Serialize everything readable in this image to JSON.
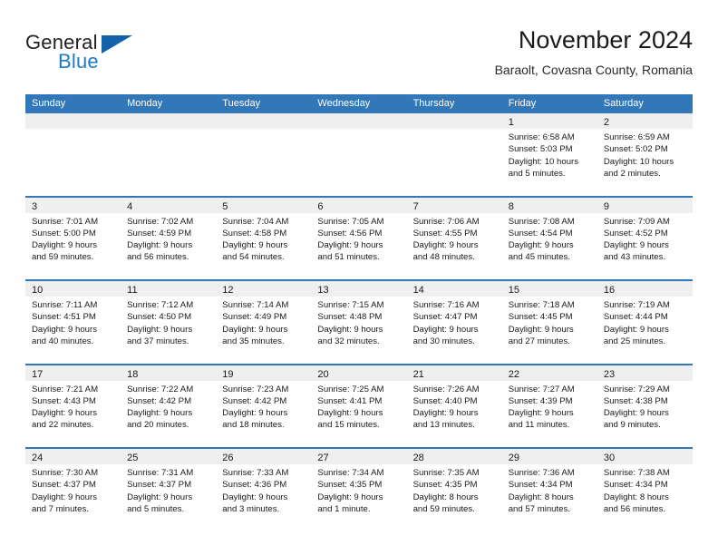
{
  "logo": {
    "word_top": "General",
    "word_bottom": "Blue",
    "triangle_color": "#1361a8",
    "blue_color": "#1b7ac9"
  },
  "header": {
    "title": "November 2024",
    "subtitle": "Baraolt, Covasna County, Romania"
  },
  "theme": {
    "header_blue": "#3277b8",
    "day_band_gray": "#efefef"
  },
  "weekday_headers": [
    "Sunday",
    "Monday",
    "Tuesday",
    "Wednesday",
    "Thursday",
    "Friday",
    "Saturday"
  ],
  "weeks": [
    [
      {
        "day": "",
        "lines": []
      },
      {
        "day": "",
        "lines": []
      },
      {
        "day": "",
        "lines": []
      },
      {
        "day": "",
        "lines": []
      },
      {
        "day": "",
        "lines": []
      },
      {
        "day": "1",
        "lines": [
          "Sunrise: 6:58 AM",
          "Sunset: 5:03 PM",
          "Daylight: 10 hours",
          "and 5 minutes."
        ]
      },
      {
        "day": "2",
        "lines": [
          "Sunrise: 6:59 AM",
          "Sunset: 5:02 PM",
          "Daylight: 10 hours",
          "and 2 minutes."
        ]
      }
    ],
    [
      {
        "day": "3",
        "lines": [
          "Sunrise: 7:01 AM",
          "Sunset: 5:00 PM",
          "Daylight: 9 hours",
          "and 59 minutes."
        ]
      },
      {
        "day": "4",
        "lines": [
          "Sunrise: 7:02 AM",
          "Sunset: 4:59 PM",
          "Daylight: 9 hours",
          "and 56 minutes."
        ]
      },
      {
        "day": "5",
        "lines": [
          "Sunrise: 7:04 AM",
          "Sunset: 4:58 PM",
          "Daylight: 9 hours",
          "and 54 minutes."
        ]
      },
      {
        "day": "6",
        "lines": [
          "Sunrise: 7:05 AM",
          "Sunset: 4:56 PM",
          "Daylight: 9 hours",
          "and 51 minutes."
        ]
      },
      {
        "day": "7",
        "lines": [
          "Sunrise: 7:06 AM",
          "Sunset: 4:55 PM",
          "Daylight: 9 hours",
          "and 48 minutes."
        ]
      },
      {
        "day": "8",
        "lines": [
          "Sunrise: 7:08 AM",
          "Sunset: 4:54 PM",
          "Daylight: 9 hours",
          "and 45 minutes."
        ]
      },
      {
        "day": "9",
        "lines": [
          "Sunrise: 7:09 AM",
          "Sunset: 4:52 PM",
          "Daylight: 9 hours",
          "and 43 minutes."
        ]
      }
    ],
    [
      {
        "day": "10",
        "lines": [
          "Sunrise: 7:11 AM",
          "Sunset: 4:51 PM",
          "Daylight: 9 hours",
          "and 40 minutes."
        ]
      },
      {
        "day": "11",
        "lines": [
          "Sunrise: 7:12 AM",
          "Sunset: 4:50 PM",
          "Daylight: 9 hours",
          "and 37 minutes."
        ]
      },
      {
        "day": "12",
        "lines": [
          "Sunrise: 7:14 AM",
          "Sunset: 4:49 PM",
          "Daylight: 9 hours",
          "and 35 minutes."
        ]
      },
      {
        "day": "13",
        "lines": [
          "Sunrise: 7:15 AM",
          "Sunset: 4:48 PM",
          "Daylight: 9 hours",
          "and 32 minutes."
        ]
      },
      {
        "day": "14",
        "lines": [
          "Sunrise: 7:16 AM",
          "Sunset: 4:47 PM",
          "Daylight: 9 hours",
          "and 30 minutes."
        ]
      },
      {
        "day": "15",
        "lines": [
          "Sunrise: 7:18 AM",
          "Sunset: 4:45 PM",
          "Daylight: 9 hours",
          "and 27 minutes."
        ]
      },
      {
        "day": "16",
        "lines": [
          "Sunrise: 7:19 AM",
          "Sunset: 4:44 PM",
          "Daylight: 9 hours",
          "and 25 minutes."
        ]
      }
    ],
    [
      {
        "day": "17",
        "lines": [
          "Sunrise: 7:21 AM",
          "Sunset: 4:43 PM",
          "Daylight: 9 hours",
          "and 22 minutes."
        ]
      },
      {
        "day": "18",
        "lines": [
          "Sunrise: 7:22 AM",
          "Sunset: 4:42 PM",
          "Daylight: 9 hours",
          "and 20 minutes."
        ]
      },
      {
        "day": "19",
        "lines": [
          "Sunrise: 7:23 AM",
          "Sunset: 4:42 PM",
          "Daylight: 9 hours",
          "and 18 minutes."
        ]
      },
      {
        "day": "20",
        "lines": [
          "Sunrise: 7:25 AM",
          "Sunset: 4:41 PM",
          "Daylight: 9 hours",
          "and 15 minutes."
        ]
      },
      {
        "day": "21",
        "lines": [
          "Sunrise: 7:26 AM",
          "Sunset: 4:40 PM",
          "Daylight: 9 hours",
          "and 13 minutes."
        ]
      },
      {
        "day": "22",
        "lines": [
          "Sunrise: 7:27 AM",
          "Sunset: 4:39 PM",
          "Daylight: 9 hours",
          "and 11 minutes."
        ]
      },
      {
        "day": "23",
        "lines": [
          "Sunrise: 7:29 AM",
          "Sunset: 4:38 PM",
          "Daylight: 9 hours",
          "and 9 minutes."
        ]
      }
    ],
    [
      {
        "day": "24",
        "lines": [
          "Sunrise: 7:30 AM",
          "Sunset: 4:37 PM",
          "Daylight: 9 hours",
          "and 7 minutes."
        ]
      },
      {
        "day": "25",
        "lines": [
          "Sunrise: 7:31 AM",
          "Sunset: 4:37 PM",
          "Daylight: 9 hours",
          "and 5 minutes."
        ]
      },
      {
        "day": "26",
        "lines": [
          "Sunrise: 7:33 AM",
          "Sunset: 4:36 PM",
          "Daylight: 9 hours",
          "and 3 minutes."
        ]
      },
      {
        "day": "27",
        "lines": [
          "Sunrise: 7:34 AM",
          "Sunset: 4:35 PM",
          "Daylight: 9 hours",
          "and 1 minute."
        ]
      },
      {
        "day": "28",
        "lines": [
          "Sunrise: 7:35 AM",
          "Sunset: 4:35 PM",
          "Daylight: 8 hours",
          "and 59 minutes."
        ]
      },
      {
        "day": "29",
        "lines": [
          "Sunrise: 7:36 AM",
          "Sunset: 4:34 PM",
          "Daylight: 8 hours",
          "and 57 minutes."
        ]
      },
      {
        "day": "30",
        "lines": [
          "Sunrise: 7:38 AM",
          "Sunset: 4:34 PM",
          "Daylight: 8 hours",
          "and 56 minutes."
        ]
      }
    ]
  ]
}
